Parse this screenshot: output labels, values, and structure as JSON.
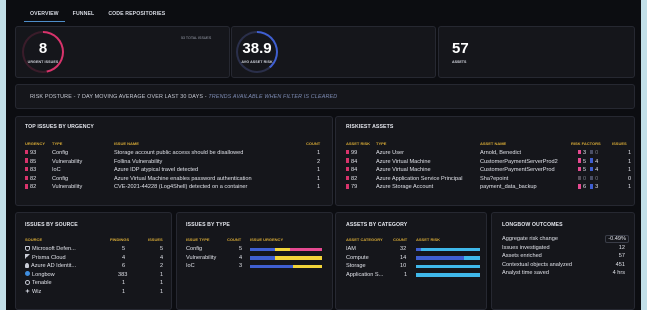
{
  "tabs": [
    {
      "label": "OVERVIEW"
    },
    {
      "label": "FUNNEL"
    },
    {
      "label": "CODE REPOSITORIES"
    }
  ],
  "summary": {
    "urgent": {
      "value": "8",
      "label": "URGENT ISSUES"
    },
    "total_issues": "53 TOTAL ISSUES",
    "avg_risk": {
      "value": "38.9",
      "label": "AVG ASSET RISK",
      "fraction": 0.389
    },
    "assets": {
      "value": "57",
      "label": "ASSETS"
    }
  },
  "risk_posture": {
    "text": "RISK POSTURE - 7 DAY MOVING AVERAGE OVER LAST 30 DAYS  -",
    "note": "TRENDS AVAILABLE WHEN FILTER IS CLEARED"
  },
  "top_issues": {
    "title": "TOP ISSUES BY URGENCY",
    "headers": [
      "URGENCY",
      "TYPE",
      "ISSUE NAME",
      "COUNT"
    ],
    "rows": [
      {
        "urgency": "93",
        "type": "Config",
        "name": "Storage account public access should be disallowed",
        "count": "1"
      },
      {
        "urgency": "85",
        "type": "Vulnerability",
        "name": "Follina Vulnerability",
        "count": "2"
      },
      {
        "urgency": "83",
        "type": "IoC",
        "name": "Azure IDP atypical travel detected",
        "count": "1"
      },
      {
        "urgency": "82",
        "type": "Config",
        "name": "Azure Virtual Machine enables password authentication",
        "count": "1"
      },
      {
        "urgency": "82",
        "type": "Vulnerability",
        "name": "CVE-2021-44228 (Log4Shell) detected on a container",
        "count": "1"
      }
    ]
  },
  "riskiest_assets": {
    "title": "RISKIEST ASSETS",
    "headers": [
      "ASSET RISK",
      "TYPE",
      "ASSET NAME",
      "RISK FACTORS",
      "ISSUES"
    ],
    "rows": [
      {
        "risk": "99",
        "type": "Azure User",
        "name": "Arnold, Benedict",
        "f1": "3",
        "f2": "0",
        "issues": "1"
      },
      {
        "risk": "84",
        "type": "Azure Virtual Machine",
        "name": "CustomerPaymentServerProd2",
        "f1": "5",
        "f2": "4",
        "issues": "1"
      },
      {
        "risk": "84",
        "type": "Azure Virtual Machine",
        "name": "CustomerPaymentServerProd",
        "f1": "5",
        "f2": "4",
        "issues": "1"
      },
      {
        "risk": "82",
        "type": "Azure Application Service Principal",
        "name": "Sha?epoint",
        "f1": "0",
        "f2": "0",
        "issues": "0"
      },
      {
        "risk": "79",
        "type": "Azure Storage Account",
        "name": "payment_data_backup",
        "f1": "6",
        "f2": "3",
        "issues": "1"
      }
    ]
  },
  "by_source": {
    "title": "ISSUES BY SOURCE",
    "headers": [
      "SOURCE",
      "FINDINGS",
      "ISSUES"
    ],
    "rows": [
      {
        "source": "Microsoft Defen...",
        "findings": "5",
        "issues": "5",
        "icon": "shield-icon"
      },
      {
        "source": "Prisma Cloud",
        "findings": "4",
        "issues": "4",
        "icon": "prisma-icon"
      },
      {
        "source": "Azure AD Identit...",
        "findings": "6",
        "issues": "2",
        "icon": "user-icon"
      },
      {
        "source": "Longbow",
        "findings": "383",
        "issues": "1",
        "icon": "cloud-icon"
      },
      {
        "source": "Tenable",
        "findings": "1",
        "issues": "1",
        "icon": "ring-icon"
      },
      {
        "source": "Wiz",
        "findings": "1",
        "issues": "1",
        "icon": "star-icon"
      }
    ]
  },
  "by_type": {
    "title": "ISSUES BY TYPE",
    "headers": [
      "ISSUE TYPE",
      "COUNT",
      "ISSUE URGENCY"
    ],
    "rows": [
      {
        "type": "Config",
        "count": "5",
        "bar": [
          0.35,
          0.2,
          0.45
        ]
      },
      {
        "type": "Vulnerability",
        "count": "4",
        "bar": [
          0.35,
          0.65,
          0
        ]
      },
      {
        "type": "IoC",
        "count": "3",
        "bar": [
          0.6,
          0.4,
          0
        ]
      }
    ]
  },
  "by_category": {
    "title": "ASSETS BY CATEGORY",
    "headers": [
      "ASSET CATEGORY",
      "COUNT",
      "ASSET RISK"
    ],
    "rows": [
      {
        "cat": "IAM",
        "count": "32",
        "bar": [
          0.08,
          0.92
        ]
      },
      {
        "cat": "Compute",
        "count": "14",
        "bar": [
          0.75,
          0.25
        ]
      },
      {
        "cat": "Storage",
        "count": "10",
        "bar": [
          0,
          1
        ]
      },
      {
        "cat": "Application S...",
        "count": "1",
        "bar": [
          0,
          1
        ]
      }
    ]
  },
  "outcomes": {
    "title": "LONGBOW OUTCOMES",
    "rows": [
      {
        "label": "Aggregate risk change",
        "value": "-0.49%"
      },
      {
        "label": "Issues investigated",
        "value": "12"
      },
      {
        "label": "Assets enriched",
        "value": "57"
      },
      {
        "label": "Contextual objects analyzed",
        "value": "451"
      },
      {
        "label": "Analyst time saved",
        "value": "4 hrs"
      }
    ]
  },
  "colors": {
    "red": "#d8336b",
    "blue": "#3f5fd1",
    "yellow": "#f2d43a",
    "pink": "#e64a91",
    "cyan": "#3fb8ea"
  }
}
